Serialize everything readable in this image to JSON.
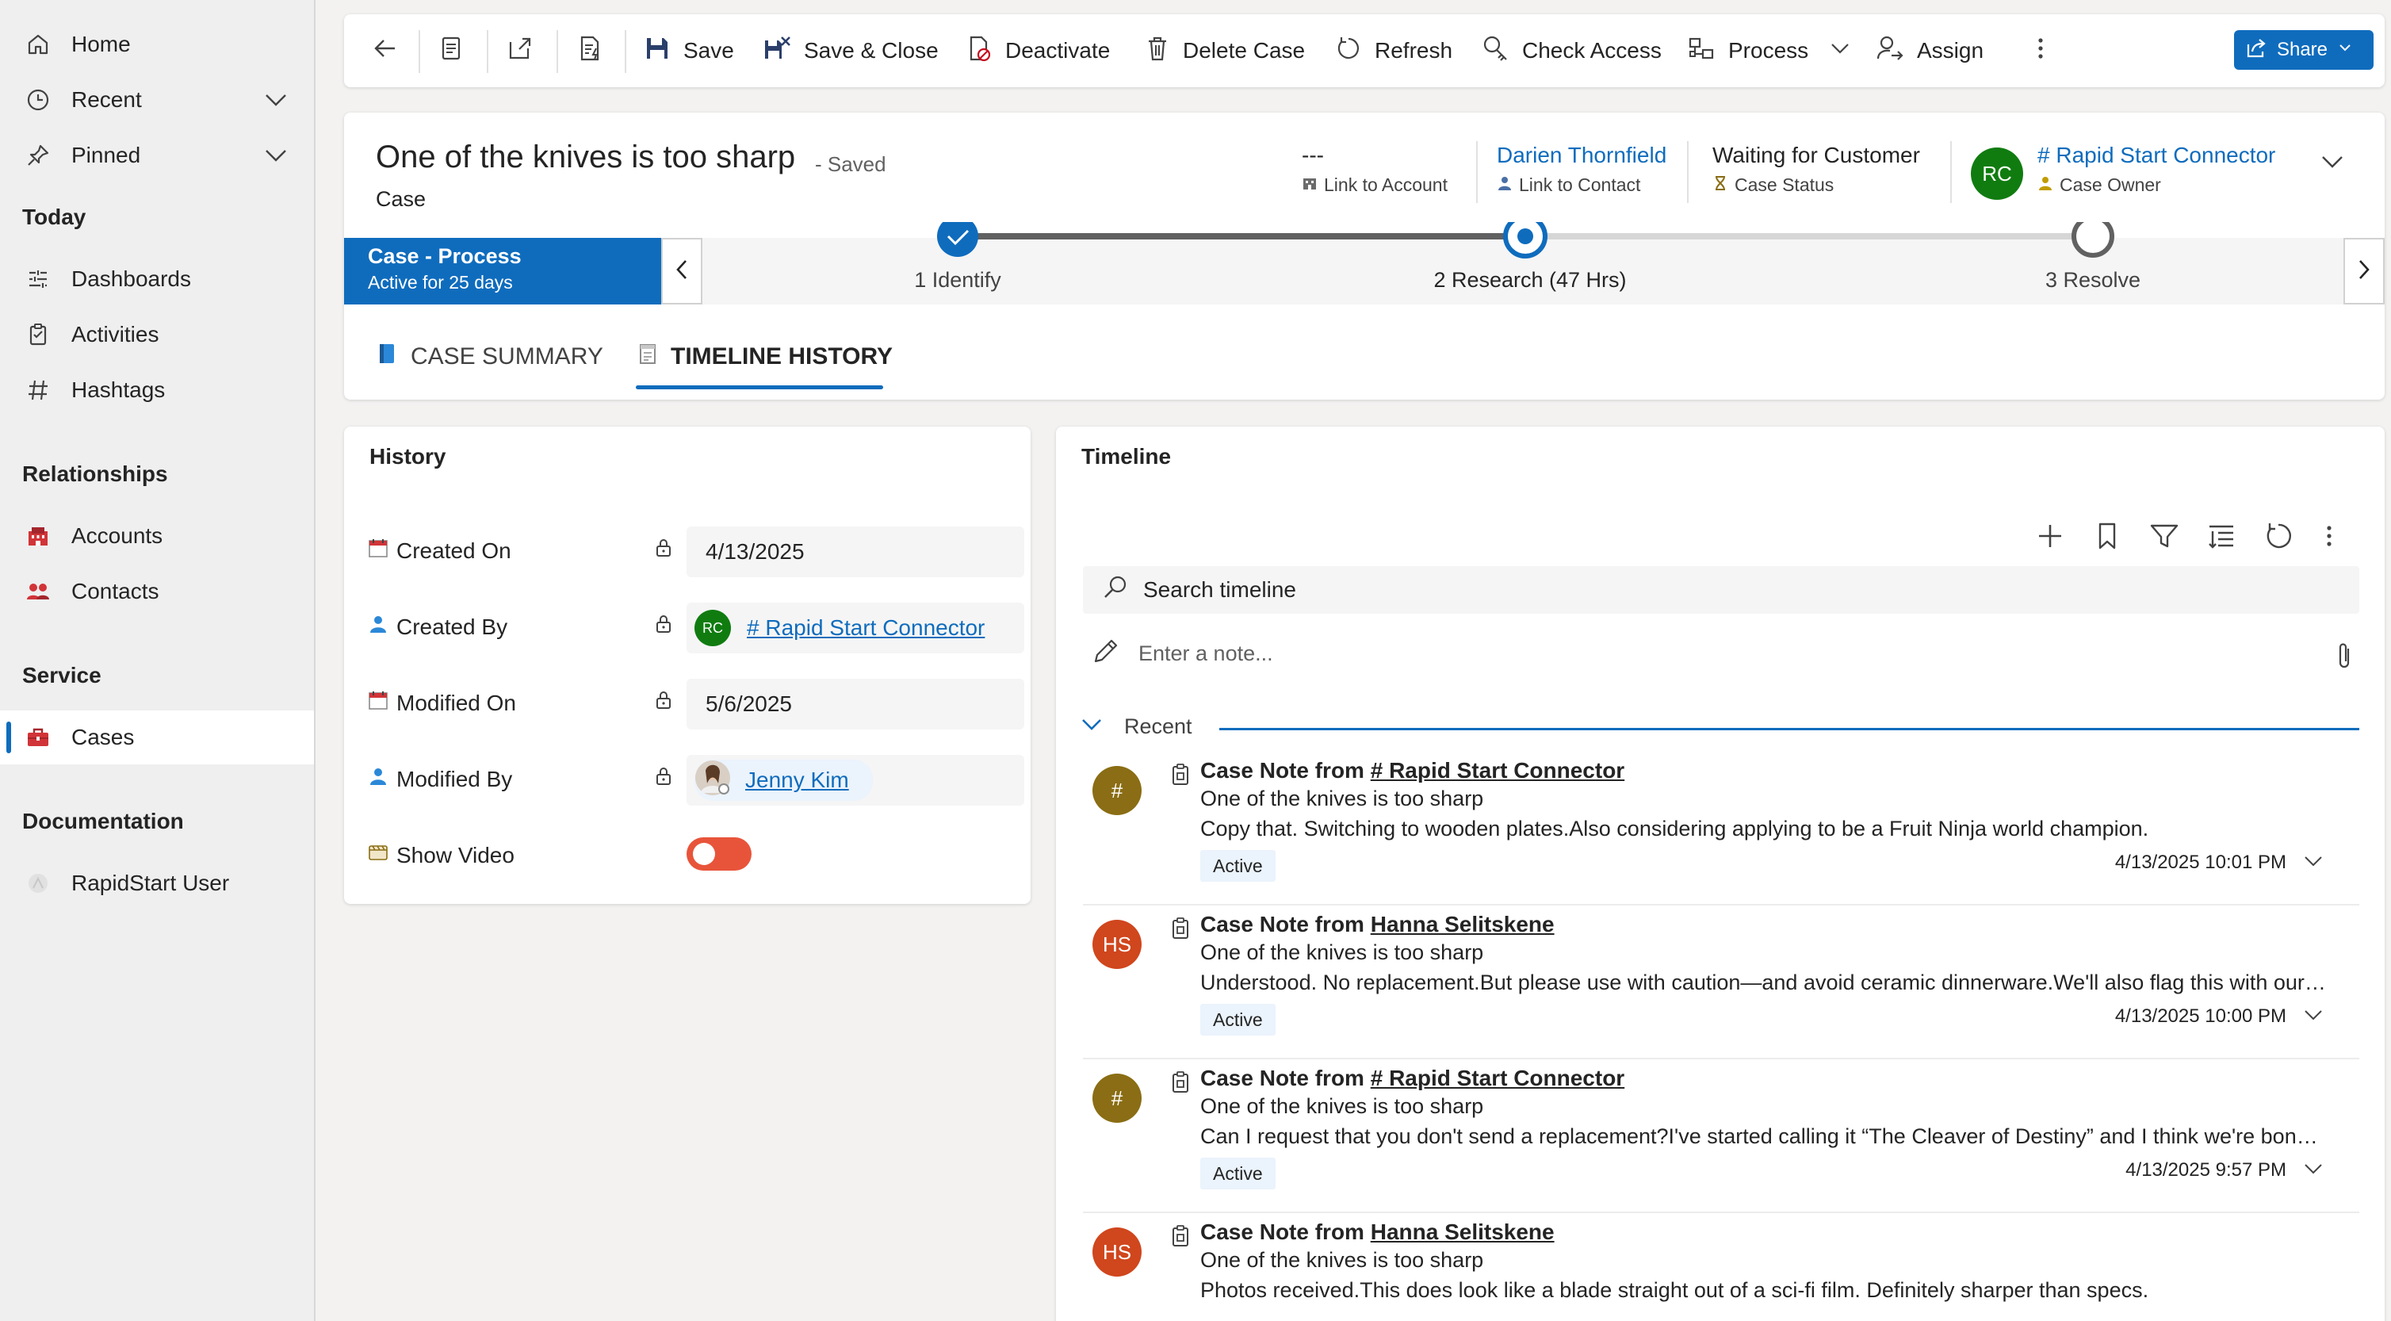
{
  "sidebar": {
    "home": "Home",
    "recent": "Recent",
    "pinned": "Pinned",
    "section_today": "Today",
    "dashboards": "Dashboards",
    "activities": "Activities",
    "hashtags": "Hashtags",
    "section_relationships": "Relationships",
    "accounts": "Accounts",
    "contacts": "Contacts",
    "section_service": "Service",
    "cases": "Cases",
    "section_documentation": "Documentation",
    "rapidstart_user": "RapidStart User"
  },
  "toolbar": {
    "save": "Save",
    "save_close": "Save & Close",
    "deactivate": "Deactivate",
    "delete_case": "Delete Case",
    "refresh": "Refresh",
    "check_access": "Check Access",
    "process": "Process",
    "assign": "Assign",
    "share": "Share"
  },
  "record": {
    "title": "One of the knives is too sharp",
    "saved_status": "- Saved",
    "entity": "Case",
    "account_value": "---",
    "account_label": "Link to Account",
    "contact_value": "Darien Thornfield",
    "contact_label": "Link to Contact",
    "status_value": "Waiting for Customer",
    "status_label": "Case Status",
    "owner_initials": "RC",
    "owner_value": "# Rapid Start Connector",
    "owner_label": "Case Owner"
  },
  "process": {
    "name": "Case - Process",
    "active_for": "Active for 25 days",
    "stages": [
      "1 Identify",
      "2 Research  (47 Hrs)",
      "3 Resolve"
    ]
  },
  "tabs": [
    "CASE SUMMARY",
    "TIMELINE HISTORY"
  ],
  "history": {
    "title": "History",
    "created_on_label": "Created On",
    "created_on": "4/13/2025",
    "created_by_label": "Created By",
    "created_by_initials": "RC",
    "created_by": "# Rapid Start Connector",
    "modified_on_label": "Modified On",
    "modified_on": "5/6/2025",
    "modified_by_label": "Modified By",
    "modified_by": "Jenny Kim",
    "show_video_label": "Show Video"
  },
  "timeline": {
    "title": "Timeline",
    "search_placeholder": "Search timeline",
    "note_placeholder": "Enter a note...",
    "recent_label": "Recent",
    "posts": [
      {
        "initials": "#",
        "title_prefix": "Case Note from",
        "author": "# Rapid Start Connector",
        "subject": "One of the knives is too sharp",
        "body": "Copy that. Switching to wooden plates.Also considering applying to be a Fruit Ninja world champion.",
        "badge": "Active",
        "time": "4/13/2025 10:01 PM",
        "color": "#8a6d14"
      },
      {
        "initials": "HS",
        "title_prefix": "Case Note from",
        "author": "Hanna Selitskene",
        "subject": "One of the knives is too sharp",
        "body": "Understood. No replacement.But please use with caution—and avoid ceramic dinnerware.We'll also flag this with our ...",
        "badge": "Active",
        "time": "4/13/2025 10:00 PM",
        "color": "#d0461d"
      },
      {
        "initials": "#",
        "title_prefix": "Case Note from",
        "author": "# Rapid Start Connector",
        "subject": "One of the knives is too sharp",
        "body": "Can I request that you don't send a replacement?I've started calling it “The Cleaver of Destiny” and I think we're bonde...",
        "badge": "Active",
        "time": "4/13/2025 9:57 PM",
        "color": "#8a6d14"
      },
      {
        "initials": "HS",
        "title_prefix": "Case Note from",
        "author": "Hanna Selitskene",
        "subject": "One of the knives is too sharp",
        "body": "Photos received.This does look like a blade straight out of a sci-fi film. Definitely sharper than specs.",
        "badge": "",
        "time": "",
        "color": "#d0461d"
      }
    ]
  },
  "colors": {
    "accent": "#0f6cbd",
    "owner_avatar": "#107c10",
    "toggle_on": "#e8543a"
  }
}
